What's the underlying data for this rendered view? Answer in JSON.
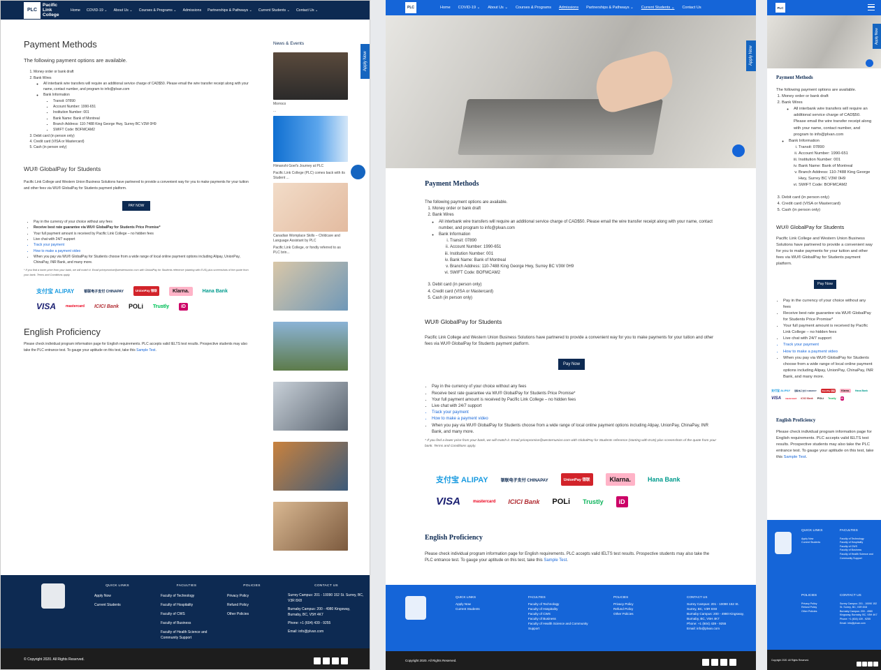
{
  "brand": {
    "logo": "PLC",
    "name_line1": "Pacific",
    "name_line2": "Link",
    "name_line3": "College"
  },
  "nav": [
    "Home",
    "COVID-19 ⌄",
    "About Us ⌄",
    "Courses & Programs ⌄",
    "Admissions",
    "Partnerships & Pathways ⌄",
    "Current Students ⌄",
    "Contact Us ⌄"
  ],
  "nav2": [
    "Home",
    "COVID-19 ⌄",
    "About Us ⌄",
    "Courses & Programs",
    "Admissions",
    "Partnerships & Pathways ⌄",
    "Current Students ⌄",
    "Contact Us"
  ],
  "apply_now": "Apply Now",
  "payment": {
    "title": "Payment Methods",
    "intro": "The following payment options are available.",
    "m1": "Money order or bank draft",
    "m2": "Bank Wires",
    "wire_note": "All interbank wire transfers will require an additional service charge of CAD$50. Please email the wire transfer receipt along with your name, contact number, and program to info@plvan.com",
    "bank_info": "Bank Information",
    "transit": "Transit: 07890",
    "account": "Account Number: 1990-651",
    "institution": "Institution Number: 001",
    "bank_name": "Bank Name: Bank of Montreal",
    "branch": "Branch Address: 110-7488 King George Hwy, Surrey BC  V3W 0H9",
    "swift": "SWIFT Code: BOFMCAM2",
    "m3": "Debit card (in person only)",
    "m4": "Credit card (VISA or Mastercard)",
    "m5": "Cash (in person only)"
  },
  "wu": {
    "title": "WU® GlobalPay for Students",
    "desc": "Pacific Link College and Western Union Business Solutions have partnered to provide a convenient way for you to make payments for your tuition and other fees via WU® GlobalPay for Students payment platform.",
    "btn_upper": "PAY NOW",
    "btn": "Pay Now",
    "b1": "Pay in the currency of your choice without any fees",
    "b2": "Receive best rate guarantee via WU® GlobalPay for Students Price Promise*",
    "b3": "Your full payment amount is received by Pacific Link College – no hidden fees",
    "b4": "Live chat with 24/7 support",
    "b5": "Track your payment",
    "b6": "How to make a payment video",
    "b7": "When you pay via WU® GlobalPay for Students choose from a wide range of local online payment options including Alipay, UnionPay, ChinaPay, INR Bank, and many more.",
    "footnote": "* If you find a lower price from your bank, we will match it. Email pricepromise@westernunion.com with GlobalPay for Students reference (starting with EUS) plus screenshots of the quote from your bank. Terms and Conditions apply."
  },
  "payment_logos": [
    "支付宝 ALIPAY",
    "银联电子支付 CHINAPAY",
    "UnionPay 银联",
    "Klarna.",
    "Hana Bank",
    "VISA",
    "mastercard",
    "ICICI Bank",
    "POLi",
    "Trustly",
    "iD"
  ],
  "english": {
    "title": "English Proficiency",
    "text": "Please check individual program information page for English requirements. PLC accepts valid IELTS test results. Prospective students may also take the PLC entrance test. To gauge your aptitude on this test, take this",
    "link": "Sample Test",
    "end": "."
  },
  "news": {
    "title": "News & Events",
    "c1": "Morroco",
    "c1b": "...",
    "c2": "Himanshi Goel's Journey at PLC",
    "c2b": "Pacific Link College (PLC) comes back with its Student ...",
    "c3": "Canadian Womplace Skills – Childcare and Language Assistant by PLC",
    "c3b": "Pacific Link College, or fondly referred to as PLC brin..."
  },
  "footer": {
    "quick_links": "QUICK LINKS",
    "ql1": "Apply Now",
    "ql2": "Current Students",
    "faculties": "FACULTIES",
    "f1": "Faculty of Technology",
    "f2": "Faculty of Hospitality",
    "f3": "Faculty of CWS",
    "f4": "Faculty of Business",
    "f5": "Faculty of Health Science and Community Support",
    "policies": "POLICIES",
    "p1": "Privacy Policy",
    "p2": "Refund Policy",
    "p3": "Other Policies",
    "contact": "CONTACT US",
    "surrey": "Surrey Campus: 201 - 10090 152 St. Surrey, BC, V3R 8X8",
    "burnaby": "Burnaby Campus: 200 - 4980 Kingsway, Burnaby, BC, V5H 4K7",
    "phone": "Phone: +1 (604) 439 - 9255",
    "email": "Email: info@plvan.com",
    "copyright": "© Copyright 2020. All Rights Reserved.",
    "copyright2": "Copyright 2020. All Rights Reserved."
  },
  "colors": {
    "navy": "#0d2a52",
    "blue": "#1565d8",
    "dark": "#1d1d1d"
  }
}
